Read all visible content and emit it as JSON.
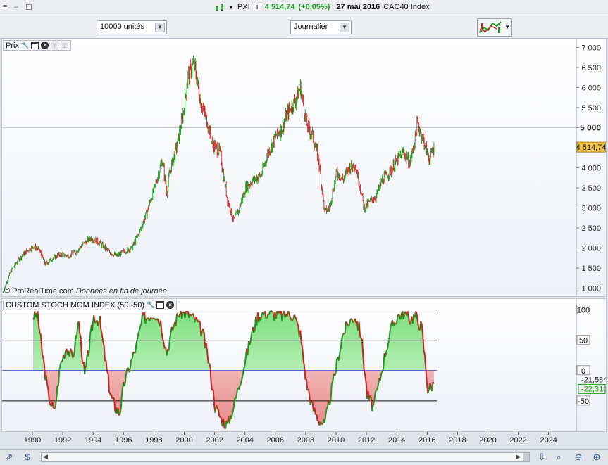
{
  "window": {
    "ticker": "PXI",
    "quote": "4 514,74",
    "change": "(+0,05%)",
    "date": "27 mai 2016",
    "instrument": "CAC40 Index"
  },
  "toolbar": {
    "units_select": "10000 unités",
    "period_select": "Journalier"
  },
  "price_panel": {
    "label": "Prix",
    "copyright": "© ProRealTime.com",
    "copyright_note": "Données en fin de journée",
    "current_price": "4 514,74",
    "y_ticks": [
      "7 000",
      "6 500",
      "6 000",
      "5 500",
      "5 000",
      "4 500",
      "4 000",
      "3 500",
      "3 000",
      "2 500",
      "2 000",
      "1 500",
      "1 000"
    ],
    "highlight_tick": "5 000"
  },
  "indicator_panel": {
    "label": "CUSTOM STOCH MOM INDEX (50 -50)",
    "levels": [
      "100",
      "50",
      "0",
      "-50"
    ],
    "value_1": "-21,584",
    "value_2": "-22,310"
  },
  "x_axis": {
    "years": [
      "1990",
      "1992",
      "1994",
      "1996",
      "1998",
      "2000",
      "2002",
      "2004",
      "2006",
      "2008",
      "2010",
      "2012",
      "2014",
      "2016",
      "2018",
      "2020",
      "2022",
      "2024"
    ]
  },
  "colors": {
    "up": "#1a9a1a",
    "down": "#d02020",
    "fill_positive": "#7fe07f",
    "fill_negative": "#e88a8a",
    "zero_line": "#2040c0",
    "price_badge": "#f5c54a"
  },
  "chart_data": {
    "type": "line",
    "price": {
      "x": [
        1988.0,
        1988.5,
        1989.0,
        1989.5,
        1990.0,
        1990.4,
        1990.8,
        1991.3,
        1991.8,
        1992.3,
        1992.8,
        1993.3,
        1993.8,
        1994.1,
        1994.6,
        1995.0,
        1995.5,
        1995.9,
        1996.5,
        1997.0,
        1997.5,
        1998.0,
        1998.5,
        1998.8,
        1999.0,
        1999.5,
        1999.9,
        2000.2,
        2000.6,
        2001.0,
        2001.5,
        2001.8,
        2002.3,
        2002.8,
        2003.2,
        2003.5,
        2004.0,
        2004.5,
        2005.0,
        2005.5,
        2006.0,
        2006.4,
        2006.8,
        2007.3,
        2007.6,
        2008.0,
        2008.4,
        2008.8,
        2009.2,
        2009.5,
        2010.0,
        2010.4,
        2010.8,
        2011.2,
        2011.5,
        2011.8,
        2012.3,
        2012.6,
        2013.0,
        2013.5,
        2014.0,
        2014.4,
        2014.8,
        2015.1,
        2015.3,
        2015.7,
        2016.1,
        2016.4
      ],
      "y": [
        900,
        1400,
        1700,
        1900,
        2050,
        1950,
        1600,
        1750,
        1850,
        1800,
        1900,
        2100,
        2250,
        2200,
        2050,
        1900,
        1800,
        1900,
        2000,
        2400,
        2900,
        3500,
        4200,
        3400,
        3900,
        4600,
        5400,
        6300,
        6600,
        5700,
        5100,
        4600,
        4400,
        3200,
        2700,
        2900,
        3500,
        3700,
        3800,
        4400,
        4800,
        5000,
        5400,
        5700,
        6000,
        5100,
        4800,
        4200,
        2900,
        3000,
        3900,
        3700,
        4000,
        4100,
        3600,
        3000,
        3200,
        3300,
        3700,
        3900,
        4200,
        4400,
        4100,
        4600,
        5100,
        4700,
        4200,
        4514.74
      ],
      "ylim": [
        800,
        7200
      ]
    },
    "stoch_mom": {
      "x": [
        1990.0,
        1990.3,
        1990.6,
        1991.0,
        1991.4,
        1991.8,
        1992.2,
        1992.6,
        1993.0,
        1993.4,
        1993.7,
        1994.0,
        1994.4,
        1994.8,
        1995.1,
        1995.4,
        1995.7,
        1996.0,
        1996.4,
        1996.8,
        1997.2,
        1997.6,
        1998.0,
        1998.4,
        1998.8,
        1999.2,
        1999.6,
        2000.0,
        2000.4,
        2000.8,
        2001.2,
        2001.6,
        2002.0,
        2002.4,
        2002.8,
        2003.2,
        2003.6,
        2004.0,
        2004.4,
        2004.8,
        2005.2,
        2005.6,
        2006.0,
        2006.4,
        2006.8,
        2007.2,
        2007.6,
        2008.0,
        2008.4,
        2008.8,
        2009.2,
        2009.6,
        2010.0,
        2010.4,
        2010.8,
        2011.2,
        2011.6,
        2012.0,
        2012.4,
        2012.8,
        2013.2,
        2013.6,
        2014.0,
        2014.4,
        2014.8,
        2015.2,
        2015.6,
        2016.0,
        2016.4
      ],
      "y": [
        90,
        92,
        30,
        -40,
        -70,
        10,
        40,
        20,
        80,
        -10,
        40,
        90,
        80,
        10,
        -40,
        -60,
        -70,
        -20,
        10,
        40,
        85,
        90,
        95,
        80,
        30,
        70,
        95,
        95,
        90,
        80,
        60,
        10,
        -60,
        -80,
        -90,
        -60,
        -20,
        20,
        60,
        90,
        95,
        95,
        92,
        90,
        95,
        90,
        60,
        -20,
        -60,
        -80,
        -90,
        -40,
        10,
        60,
        80,
        90,
        60,
        -40,
        -60,
        -20,
        30,
        70,
        90,
        95,
        85,
        90,
        70,
        -30,
        -21.584
      ],
      "levels": [
        100,
        50,
        0,
        -50
      ],
      "ylim": [
        -100,
        118
      ]
    }
  }
}
